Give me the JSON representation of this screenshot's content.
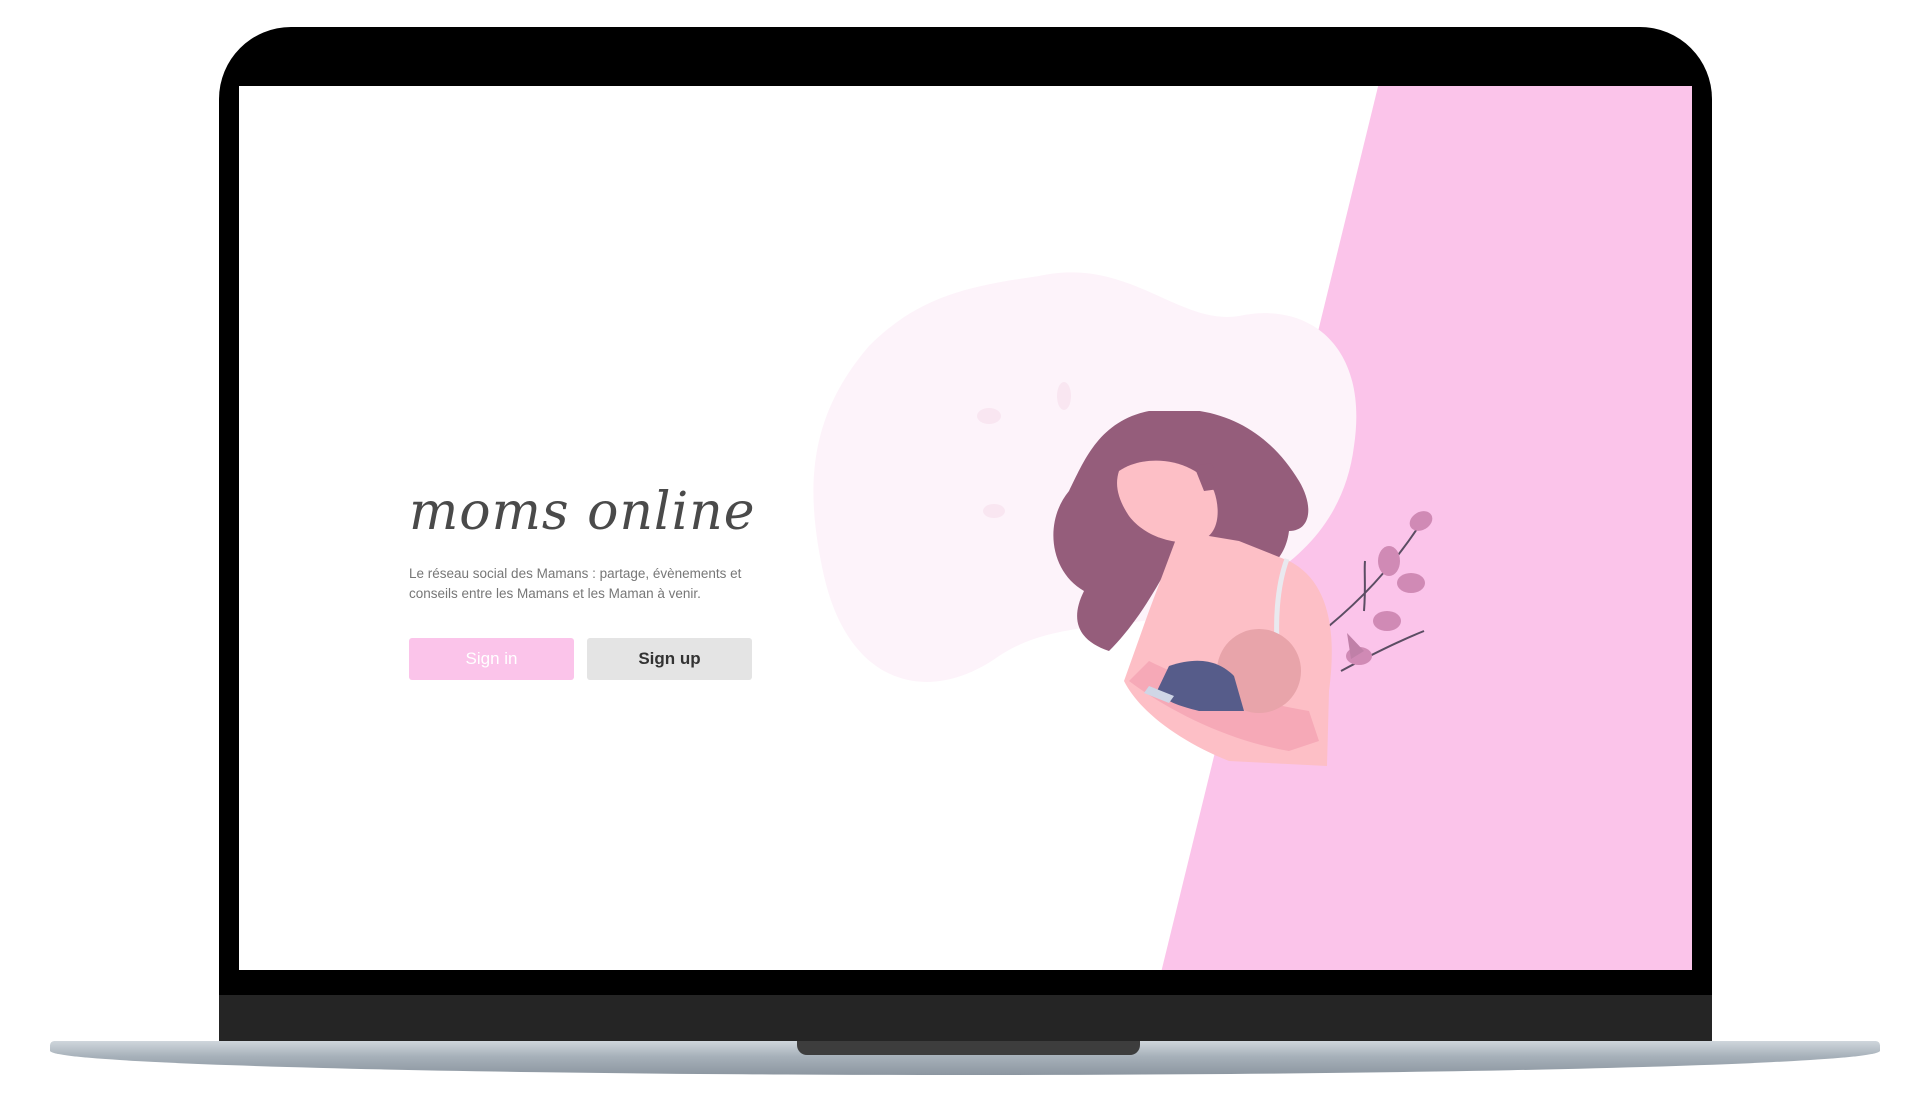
{
  "app": {
    "title": "moms online",
    "tagline": "Le réseau social des Mamans : partage, évènements et conseils entre les Mamans et les Maman à venir."
  },
  "buttons": {
    "sign_in": "Sign in",
    "sign_up": "Sign up"
  },
  "colors": {
    "accent_pink": "#fbc4ea",
    "hair": "#955d7b",
    "skin": "#fdbfc6",
    "baby_cloth": "#565c8a",
    "button_gray": "#e4e4e4",
    "text": "#4a4a4a"
  },
  "illustration": {
    "subject": "mother-breastfeeding-baby-illustration"
  }
}
